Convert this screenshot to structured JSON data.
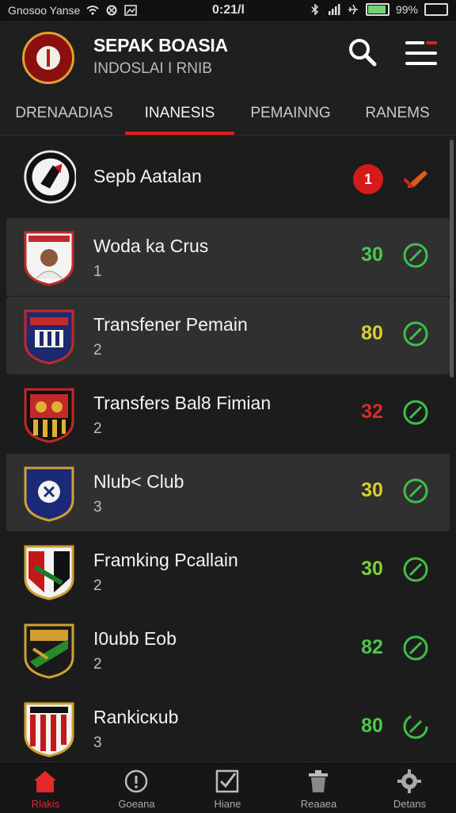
{
  "status_bar": {
    "carrier": "Gnosoo Yanse",
    "time": "0:21/l",
    "battery": "99%",
    "battery_level": 0.99
  },
  "header": {
    "title": "SEPAK BOASIA",
    "subtitle": "INDOSLAI I RNIB"
  },
  "tabs": [
    {
      "label": "DRENAADIAS",
      "active": false
    },
    {
      "label": "INANESIS",
      "active": true
    },
    {
      "label": "PEMAINNG",
      "active": false
    },
    {
      "label": "RANEMS",
      "active": false
    }
  ],
  "featured": {
    "name": "Sepb Aatalan",
    "badge_count": "1"
  },
  "clubs": [
    {
      "name": "Woda ka Crus",
      "rank": "1",
      "score": "30",
      "score_color": "#4bc84b"
    },
    {
      "name": "Transfener Pemain",
      "rank": "2",
      "score": "80",
      "score_color": "#d8cf2a"
    },
    {
      "name": "Transfers Bal8 Fimian",
      "rank": "2",
      "score": "32",
      "score_color": "#d62b2b"
    },
    {
      "name": "Nlub< Club",
      "rank": "3",
      "score": "30",
      "score_color": "#d8cf2a"
    },
    {
      "name": "Framking Pcallain",
      "rank": "2",
      "score": "30",
      "score_color": "#7fcf3a"
    },
    {
      "name": "I0ubb Eob",
      "rank": "2",
      "score": "82",
      "score_color": "#4bc84b"
    },
    {
      "name": "Rankicĸub",
      "rank": "3",
      "score": "80",
      "score_color": "#4bc84b"
    }
  ],
  "bottom_nav": [
    {
      "label": "Rlakis",
      "icon": "home-icon",
      "active": true
    },
    {
      "label": "Goeana",
      "icon": "info-icon",
      "active": false
    },
    {
      "label": "Hiane",
      "icon": "checklist-icon",
      "active": false
    },
    {
      "label": "Reaaea",
      "icon": "trash-icon",
      "active": false
    },
    {
      "label": "Detans",
      "icon": "gear-icon",
      "active": false
    }
  ],
  "colors": {
    "accent": "#e02020",
    "background": "#1c1c1c",
    "check_green": "#3fbf4a"
  }
}
